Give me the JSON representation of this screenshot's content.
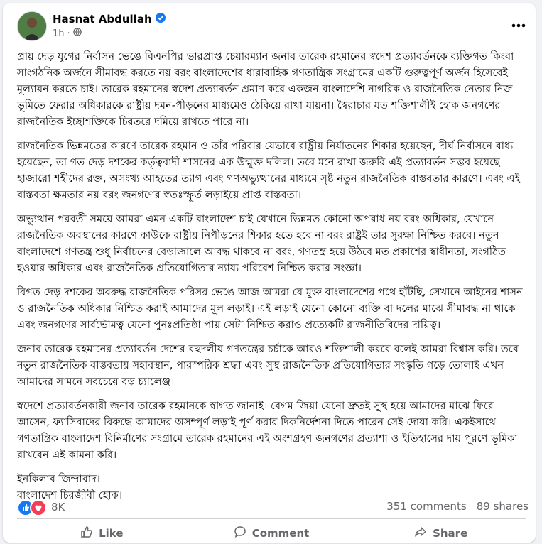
{
  "post": {
    "author": "Hasnat Abdullah",
    "time": "1h",
    "paragraphs": [
      "প্রায় দেড় যুগের নির্বাসন ভেঙে বিএনপির ভারপ্রাপ্ত চেয়ারম্যান জনাব তারেক রহমানের স্বদেশ প্রত্যাবর্তনকে ব্যক্তিগত কিংবা সাংগঠনিক অর্জনে সীমাবদ্ধ করতে নয় বরং বাংলাদেশের ধারাবাহিক গণতান্ত্রিক সংগ্রামের একটি গুরুত্বপূর্ণ অর্জন হিসেবেই মূল্যায়ন করতে চাই। তারেক রহমানের স্বদেশ প্রত্যাবর্তন প্রমাণ করে একজন বাংলাদেশি নাগরিক ও রাজনৈতিক নেতার নিজ ভূমিতে ফেরার অধিকারকে রাষ্ট্রীয় দমন-পীড়নের মাধ্যমেও ঠেকিয়ে রাখা যায়না। স্বৈরাচার যত শক্তিশালীই হোক জনগণের রাজনৈতিক ইচ্ছাশক্তিকে চিরতরে দমিয়ে রাখতে পারে না।",
      "রাজনৈতিক ভিন্নমতের কারণে তারেক রহমান ও তাঁর পরিবার যেভাবে রাষ্ট্রীয় নির্যাতনের শিকার হয়েছেন, দীর্ঘ নির্বাসনে বাধ্য হয়েছেন, তা গত দেড় দশকের কর্তৃত্ববাদী শাসনের এক উন্মুক্ত দলিল। তবে মনে রাখা জরুরি এই প্রত্যাবর্তন সম্ভব হয়েছে হাজারো শহীদের রক্ত, অসংখ্য আহতের ত্যাগ এবং গণঅভ্যুত্থানের মাধ্যমে সৃষ্ট নতুন রাজনৈতিক বাস্তবতার কারণে। এবং এই বাস্তবতা ক্ষমতার নয় বরং জনগণের স্বতঃস্ফূর্ত লড়াইয়ে প্রাপ্ত বাস্তবতা।",
      "অভ্যুত্থান পরবর্তী সময়ে আমরা এমন একটি বাংলাদেশ চাই যেখানে ভিন্নমত কোনো অপরাধ নয় বরং অধিকার, যেখানে রাজনৈতিক অবস্থানের কারণে কাউকে রাষ্ট্রীয় নিপীড়নের শিকার হতে হবে না বরং রাষ্ট্রই তার সুরক্ষা নিশ্চিত করবে। নতুন বাংলাদেশে গণতন্ত্র শুধু নির্বাচনের বেড়াজালে আবদ্ধ থাকবে না বরং, গণতন্ত্র হয়ে উঠবে মত প্রকাশের স্বাধীনতা, সংগঠিত হওয়ার অধিকার এবং রাজনৈতিক প্রতিযোগিতার ন্যায্য পরিবেশ নিশ্চিত করার সংজ্ঞা।",
      "বিগত দেড় দশকের অবরুদ্ধ রাজনৈতিক পরিসর ভেঙে আজ আমরা যে মুক্ত বাংলাদেশের পথে হাঁটছি, সেখানে আইনের শাসন ও রাজনৈতিক অধিকার নিশ্চিত করাই আমাদের মূল লড়াই। এই লড়াই যেনো কোনো ব্যক্তি বা দলের মাঝে সীমাবদ্ধ না থাকে এবং জনগণের সার্বভৌমত্ব যেনো পুনঃপ্রতিষ্ঠা পায় সেটা নিশ্চিত করাও প্রত্যেকটি রাজনীতিবিদের দায়িত্ব।",
      "জনাব তারেক রহমানের প্রত্যাবর্তন দেশের বহুদলীয় গণতন্ত্রের চর্চাকে আরও শক্তিশালী করবে বলেই আমরা বিশ্বাস করি। তবে নতুন রাজনৈতিক বাস্তবতায় সহাবস্থান, পারস্পরিক শ্রদ্ধা এবং সুস্থ রাজনৈতিক প্রতিযোগিতার সংস্কৃতি গড়ে তোলাই এখন আমাদের সামনে সবচেয়ে বড় চ্যালেঞ্জ।",
      "স্বদেশে প্রত্যাবর্তনকারী জনাব তারেক রহমানকে স্বাগত জানাই। বেগম জিয়া যেনো দ্রুতই সুস্থ হয়ে আমাদের মাঝে ফিরে আসেন, ফ্যাসিবাদের বিরুদ্ধে আমাদের অসম্পূর্ণ লড়াই পূর্ণ করার দিকনির্দেশনা দিতে পারেন সেই দোয়া করি। একইসাথে গণতান্ত্রিক বাংলাদেশ বিনির্মাণের সংগ্রামে তারেক রহমানের এই অংশগ্রহণ জনগণের প্রত্যাশা ও ইতিহাসের দায় পূরণে ভূমিকা রাখবেন এই কামনা করি।"
    ],
    "closing_line1": "ইনকিলাব জিন্দাবাদ।",
    "closing_line2": "বাংলাদেশ চিরজীবী হোক।"
  },
  "engagement": {
    "reaction_count": "8K",
    "comments": "351 comments",
    "shares": "89 shares"
  },
  "actions": {
    "like": "Like",
    "comment": "Comment",
    "share": "Share"
  },
  "colors": {
    "verified": "#1877f2",
    "like": "#1877f2",
    "love": "#f33e58",
    "muted": "#65676b"
  },
  "icons": [
    "verified-badge-icon",
    "globe-icon",
    "more-icon",
    "like-reaction-icon",
    "love-reaction-icon",
    "thumbs-up-icon",
    "comment-icon",
    "share-icon"
  ]
}
